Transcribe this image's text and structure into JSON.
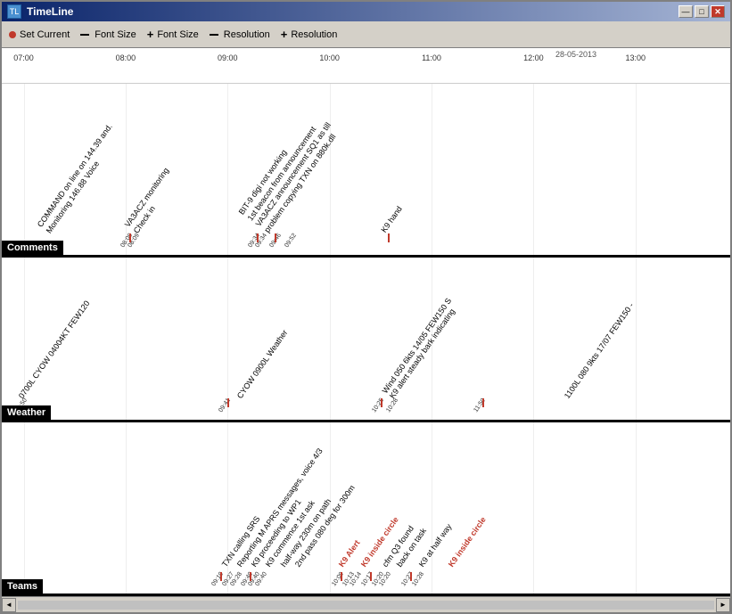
{
  "window": {
    "title": "TimeLine",
    "icon": "TL"
  },
  "toolbar": {
    "items": [
      {
        "label": "Set Current",
        "icon": "dot"
      },
      {
        "label": "Font Size",
        "icon": "minus"
      },
      {
        "label": "Font Size",
        "icon": "plus"
      },
      {
        "label": "Resolution",
        "icon": "minus"
      },
      {
        "label": "Resolution",
        "icon": "plus"
      }
    ]
  },
  "date_label": "28-05-2013",
  "time_labels": [
    "07:00",
    "08:00",
    "09:00",
    "10:00",
    "11:00",
    "12:00",
    "13:00"
  ],
  "sections": {
    "comments": {
      "label": "Comments",
      "entries": [
        {
          "text": "COMMAND on line on 144.39 and.\nMonitoring 146.88 Voice",
          "x_pct": 8
        },
        {
          "text": "VA3ACZ monitoring\nCheck in",
          "x_pct": 20
        },
        {
          "text": "BIT-9 digi not working\n1st beacon from announcement\nVA3ACZ announcement SQ1 as till\nproblem copying TXN on 880k.dll",
          "x_pct": 42
        },
        {
          "text": "K9 hand",
          "x_pct": 54
        }
      ],
      "tick_labels": [
        "08:08",
        "08:09",
        "09:34",
        "09:34",
        "09:46",
        "09:52"
      ]
    },
    "weather": {
      "label": "Weather",
      "entries": [
        {
          "text": "0700L CYOW 04004KT FEW120",
          "x_pct": 5
        },
        {
          "text": "CYOW 0900L Weather",
          "x_pct": 35
        },
        {
          "text": "Wind 050 6kts 14/05 FEW150 S\nK9 alert steady bark indicating",
          "x_pct": 57
        },
        {
          "text": "1100L 080 9kts 17/07 FEW150 -",
          "x_pct": 80
        }
      ],
      "tick_labels": [
        "09:50",
        "09:41",
        "10:25",
        "10:28",
        "11:50"
      ]
    },
    "teams": {
      "label": "Teams",
      "entries": [
        {
          "text": "TXN calling SRS",
          "x_pct": 33
        },
        {
          "text": "Reporting M APRS messages, voice 4/3",
          "x_pct": 35
        },
        {
          "text": "K9 proceeding to WP1",
          "x_pct": 38
        },
        {
          "text": "K9 commence 1st ask",
          "x_pct": 41
        },
        {
          "text": "half-way 230m on path",
          "x_pct": 44
        },
        {
          "text": "2nd pass 080 deg for 300m",
          "x_pct": 47
        },
        {
          "text": "K9 Alert",
          "x_pct": 50,
          "color": "red"
        },
        {
          "text": "K9 inside circle",
          "x_pct": 52,
          "color": "red"
        },
        {
          "text": "cfm Q3 found",
          "x_pct": 55
        },
        {
          "text": "back on task",
          "x_pct": 57
        },
        {
          "text": "K9 at half way",
          "x_pct": 60
        },
        {
          "text": "K9 inside circle",
          "x_pct": 63,
          "color": "red"
        }
      ],
      "tick_labels": [
        "09:10",
        "09:27",
        "09:28",
        "09:40",
        "09:40",
        "09:40",
        "10:09",
        "10:13",
        "10:14",
        "10:17",
        "10:20",
        "10:20",
        "10:27",
        "10:28"
      ]
    }
  },
  "controls": {
    "minimize": "—",
    "maximize": "□",
    "close": "✕"
  }
}
